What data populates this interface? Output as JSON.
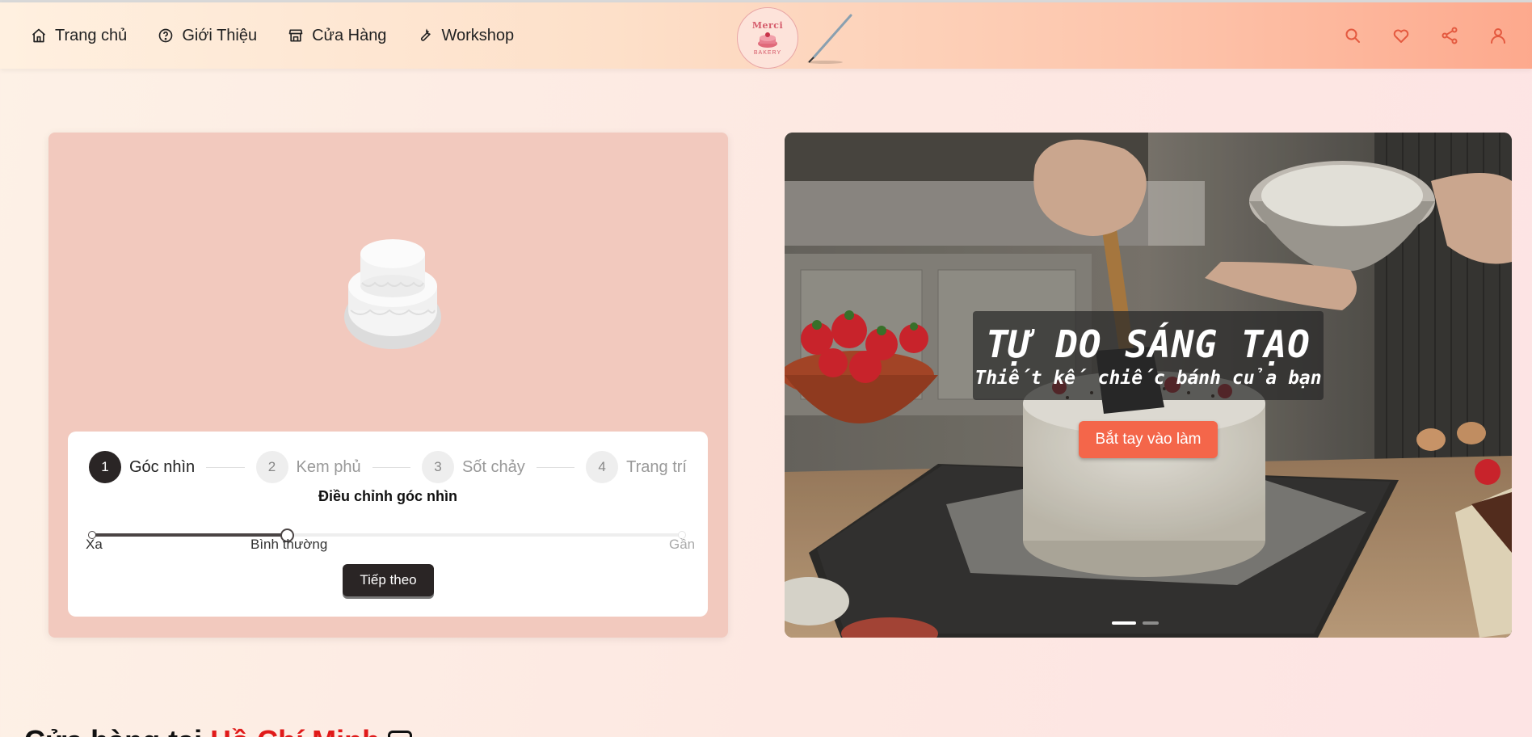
{
  "header": {
    "nav": [
      {
        "label": "Trang chủ",
        "icon": "home-icon"
      },
      {
        "label": "Giới Thiệu",
        "icon": "question-icon"
      },
      {
        "label": "Cửa Hàng",
        "icon": "store-icon"
      },
      {
        "label": "Workshop",
        "icon": "wrench-icon"
      }
    ],
    "logo_text": "Merci",
    "logo_sub": "BAKERY",
    "actions": [
      "search-icon",
      "heart-icon",
      "share-icon",
      "user-icon"
    ]
  },
  "designer": {
    "steps": [
      {
        "num": "1",
        "label": "Góc nhìn",
        "active": true
      },
      {
        "num": "2",
        "label": "Kem phủ",
        "active": false
      },
      {
        "num": "3",
        "label": "Sốt chảy",
        "active": false
      },
      {
        "num": "4",
        "label": "Trang trí",
        "active": false
      }
    ],
    "title": "Điều chỉnh góc nhìn",
    "slider": {
      "value_fraction": 0.33,
      "marks": [
        "Xa",
        "Bình thường",
        "Gần"
      ]
    },
    "next_label": "Tiếp theo"
  },
  "hero": {
    "title": "TỰ DO SÁNG TẠO",
    "subtitle": "Thiết kế chiếc bánh của bạn",
    "cta": "Bắt tay vào làm",
    "slides": 2,
    "active_slide": 1
  },
  "section_heading": {
    "prefix": "Cửa hàng tại ",
    "city": "Hồ Chí Minh"
  },
  "colors": {
    "accent": "#f4664a",
    "dark": "#2a2525",
    "card": "#f2c9be",
    "city": "#e01a1a"
  }
}
